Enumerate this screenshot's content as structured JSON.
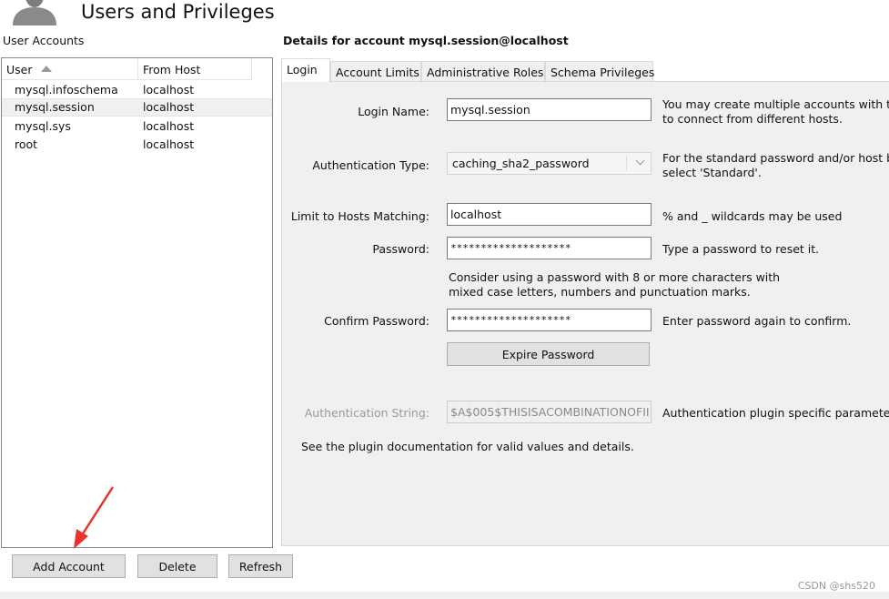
{
  "header": {
    "title": "Users and Privileges",
    "icon": "user-silhouette-icon"
  },
  "user_accounts": {
    "label": "User Accounts",
    "columns": [
      "User",
      "From Host"
    ],
    "rows": [
      {
        "user": "mysql.infoschema",
        "host": "localhost"
      },
      {
        "user": "mysql.session",
        "host": "localhost",
        "selected": true
      },
      {
        "user": "mysql.sys",
        "host": "localhost"
      },
      {
        "user": "root",
        "host": "localhost"
      }
    ]
  },
  "details": {
    "title": "Details for account mysql.session@localhost",
    "tabs": [
      "Login",
      "Account Limits",
      "Administrative Roles",
      "Schema Privileges"
    ],
    "active_tab": "Login",
    "login_name": {
      "label": "Login Name:",
      "value": "mysql.session",
      "hint_1": "You may create multiple accounts with the",
      "hint_2": "to connect from different hosts."
    },
    "auth_type": {
      "label": "Authentication Type:",
      "value": "caching_sha2_password",
      "hint_1": "For the standard password and/or host ba",
      "hint_2": "select 'Standard'."
    },
    "limit_hosts": {
      "label": "Limit to Hosts Matching:",
      "value": "localhost",
      "hint": "% and _ wildcards may be used"
    },
    "password": {
      "label": "Password:",
      "value": "********************",
      "hint": "Type a password to reset it."
    },
    "password_advice": {
      "line_1": "Consider using a password with 8 or more characters with",
      "line_2": "mixed case letters, numbers and punctuation marks."
    },
    "confirm_password": {
      "label": "Confirm Password:",
      "value": "********************",
      "hint": "Enter password again to confirm."
    },
    "expire_button": "Expire Password",
    "auth_string": {
      "label": "Authentication String:",
      "value": "$A$005$THISISACOMBINATIONOFII",
      "hint": "Authentication plugin specific parameters."
    },
    "plugin_note": "See the plugin documentation for valid values and details."
  },
  "buttons": {
    "add_account": "Add Account",
    "delete": "Delete",
    "refresh": "Refresh"
  },
  "watermark": "CSDN @shs520",
  "colors": {
    "annotation_arrow": "#e8322b",
    "panel_bg": "#f0f0f0",
    "button_bg": "#e1e1e1"
  }
}
